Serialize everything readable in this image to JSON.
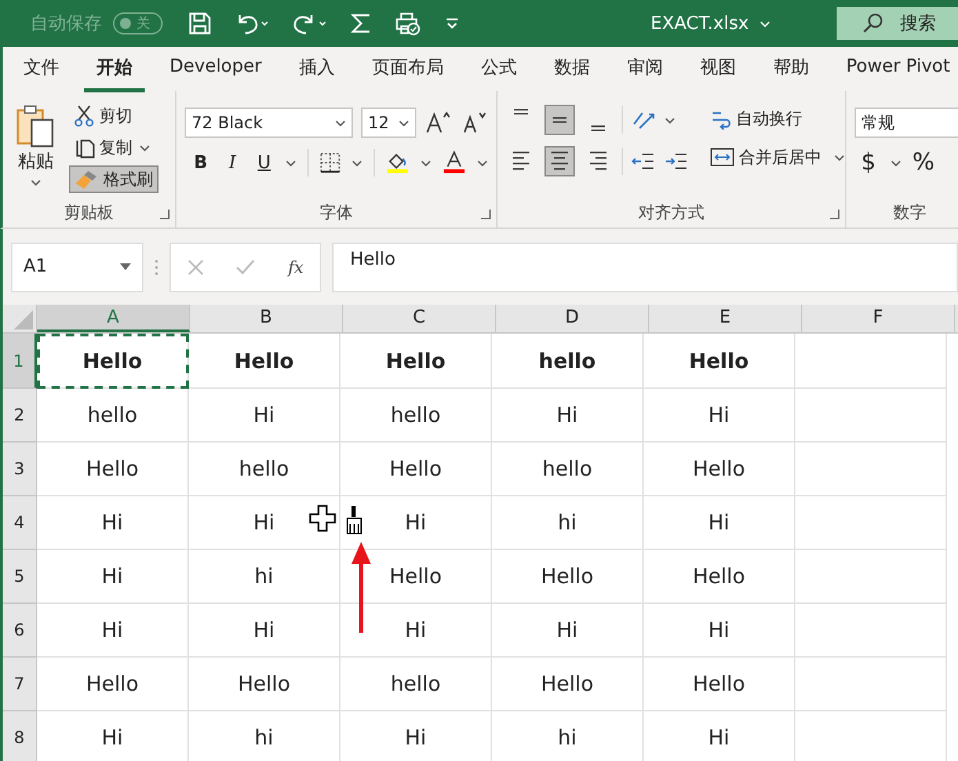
{
  "title_bar": {
    "autosave_label": "自动保存",
    "autosave_toggle": {
      "label": "关",
      "on": false
    },
    "filename": "EXACT.xlsx",
    "search_label": "搜索"
  },
  "ribbon_tabs": [
    {
      "label": "文件",
      "selected": false
    },
    {
      "label": "开始",
      "selected": true
    },
    {
      "label": "Developer",
      "selected": false
    },
    {
      "label": "插入",
      "selected": false
    },
    {
      "label": "页面布局",
      "selected": false
    },
    {
      "label": "公式",
      "selected": false
    },
    {
      "label": "数据",
      "selected": false
    },
    {
      "label": "审阅",
      "selected": false
    },
    {
      "label": "视图",
      "selected": false
    },
    {
      "label": "帮助",
      "selected": false
    },
    {
      "label": "Power Pivot",
      "selected": false
    }
  ],
  "clipboard": {
    "paste": "粘贴",
    "cut": "剪切",
    "copy": "复制",
    "format_painter": {
      "label": "格式刷",
      "selected": true
    },
    "group_label": "剪贴板"
  },
  "font": {
    "font_name": "72 Black",
    "font_size": "12",
    "bold": "B",
    "italic": "I",
    "underline": "U",
    "group_label": "字体"
  },
  "alignment": {
    "vertical": [
      {
        "kind": "top",
        "selected": false
      },
      {
        "kind": "middle",
        "selected": true
      },
      {
        "kind": "bottom",
        "selected": false
      }
    ],
    "horizontal": [
      {
        "kind": "left",
        "selected": false
      },
      {
        "kind": "center",
        "selected": true
      },
      {
        "kind": "right",
        "selected": false
      }
    ],
    "wrap_text": "自动换行",
    "merge_center": "合并后居中",
    "group_label": "对齐方式"
  },
  "number": {
    "format": "常规",
    "currency": "$",
    "percent": "%",
    "group_label": "数字"
  },
  "formula_bar": {
    "name_box": "A1",
    "function_button": "fx",
    "formula": "Hello"
  },
  "sheet": {
    "columns": [
      {
        "label": "A",
        "selected": true
      },
      {
        "label": "B",
        "selected": false
      },
      {
        "label": "C",
        "selected": false
      },
      {
        "label": "D",
        "selected": false
      },
      {
        "label": "E",
        "selected": false
      },
      {
        "label": "F",
        "selected": false
      }
    ],
    "rows": [
      {
        "header": "1",
        "selected": true,
        "bold": true,
        "cells": [
          "Hello",
          "Hello",
          "Hello",
          "hello",
          "Hello"
        ]
      },
      {
        "header": "2",
        "selected": false,
        "bold": false,
        "cells": [
          "hello",
          "Hi",
          "hello",
          "Hi",
          "Hi"
        ]
      },
      {
        "header": "3",
        "selected": false,
        "bold": false,
        "cells": [
          "Hello",
          "hello",
          "Hello",
          "hello",
          "Hello"
        ]
      },
      {
        "header": "4",
        "selected": false,
        "bold": false,
        "cells": [
          "Hi",
          "Hi",
          "Hi",
          "hi",
          "Hi"
        ]
      },
      {
        "header": "5",
        "selected": false,
        "bold": false,
        "cells": [
          "Hi",
          "hi",
          "Hello",
          "Hello",
          "Hello"
        ]
      },
      {
        "header": "6",
        "selected": false,
        "bold": false,
        "cells": [
          "Hi",
          "Hi",
          "Hi",
          "Hi",
          "Hi"
        ]
      },
      {
        "header": "7",
        "selected": false,
        "bold": false,
        "cells": [
          "Hello",
          "Hello",
          "hello",
          "Hello",
          "Hello"
        ]
      },
      {
        "header": "8",
        "selected": false,
        "bold": false,
        "cells": [
          "Hi",
          "hi",
          "Hi",
          "hi",
          "Hi"
        ]
      }
    ]
  }
}
